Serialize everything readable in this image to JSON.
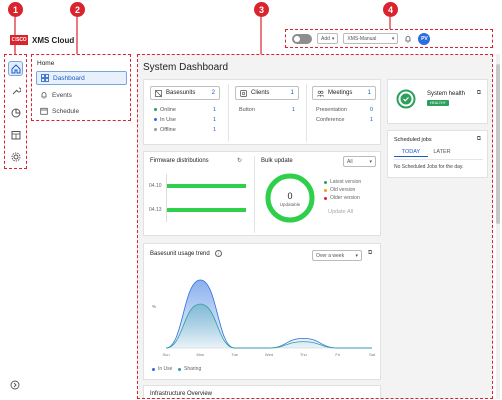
{
  "brand": {
    "logo_text": "CISCO",
    "name": "XMS Cloud"
  },
  "callouts": [
    "1",
    "2",
    "3",
    "4"
  ],
  "rail": {
    "icons": [
      "home-icon",
      "wrench-icon",
      "pie-chart-icon",
      "calendar-grid-icon",
      "gear-icon"
    ],
    "bottom_icon": "expand-icon"
  },
  "nav": {
    "home": "Home",
    "items": [
      {
        "label": "Dashboard",
        "icon": "grid-icon",
        "active": true
      },
      {
        "label": "Events",
        "icon": "bell-icon"
      },
      {
        "label": "Schedule",
        "icon": "calendar-icon"
      }
    ]
  },
  "toolbar": {
    "add_label": "Add",
    "select_value": "XMS-Manual",
    "avatar": "PV"
  },
  "main": {
    "title": "System Dashboard",
    "basesunits": {
      "label": "Basesunits",
      "count": "2",
      "rows": [
        [
          "Online",
          "1",
          "#2ca05a"
        ],
        [
          "In Use",
          "1",
          "#2a6ee0"
        ],
        [
          "Offline",
          "1",
          "#999999"
        ]
      ]
    },
    "clients": {
      "label": "Clients",
      "count": "1",
      "rows": [
        [
          "Button",
          "1"
        ]
      ]
    },
    "meetings": {
      "label": "Meetings",
      "count": "1",
      "rows": [
        [
          "Presentation",
          "0"
        ],
        [
          "Conference",
          "1"
        ]
      ]
    },
    "health": {
      "label": "System health",
      "badge": "HEALTHY"
    },
    "scheduled": {
      "title": "Scheduled jobs",
      "tabs": [
        "TODAY",
        "LATER"
      ],
      "empty": "No Scheduled Jobs for the day."
    },
    "firmware": {
      "title": "Firmware distributions",
      "bars": [
        {
          "label": "04.10",
          "value": 1
        },
        {
          "label": "04.13",
          "value": 1
        }
      ]
    },
    "bulk": {
      "title": "Bulk update",
      "select": "All",
      "count": "0",
      "ring_label": "Updatable",
      "legend": [
        [
          "Latest version",
          "#2ca05a"
        ],
        [
          "Old version",
          "#f0a020"
        ],
        [
          "Older version",
          "#d9232d"
        ]
      ],
      "button": "Update All"
    },
    "trend": {
      "title": "Basesunit usage trend",
      "select": "Over a week",
      "ylabel": "%",
      "legend": [
        [
          "In Use",
          "#2a6ee0"
        ],
        [
          "Sharing",
          "#2aa0a0"
        ]
      ]
    },
    "infra": {
      "title": "Infrastructure Overview"
    }
  },
  "chart_data": {
    "type": "area",
    "title": "Basesunit usage trend",
    "x": [
      "Sun",
      "Mon",
      "Tue",
      "Wed",
      "Thu",
      "Fri",
      "Sat"
    ],
    "ylim": [
      0,
      100
    ],
    "series": [
      {
        "name": "In Use",
        "values": [
          0,
          85,
          0,
          0,
          12,
          0,
          0
        ]
      },
      {
        "name": "Sharing",
        "values": [
          0,
          55,
          0,
          0,
          8,
          0,
          0
        ]
      }
    ]
  }
}
